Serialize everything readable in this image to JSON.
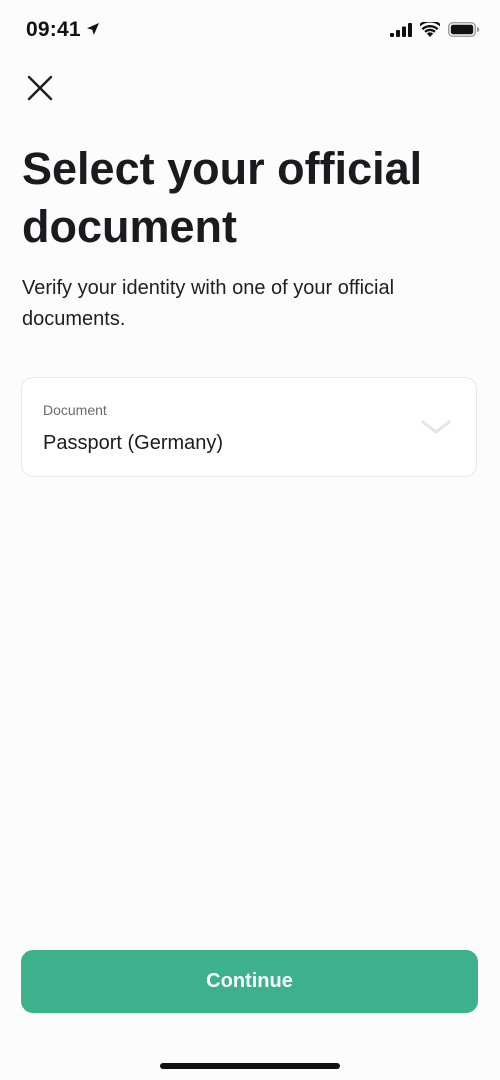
{
  "status_bar": {
    "time": "09:41"
  },
  "header": {
    "title": "Select your official document",
    "subtitle": "Verify your identity with one of your official documents."
  },
  "document_select": {
    "label": "Document",
    "value": "Passport (Germany)"
  },
  "actions": {
    "continue_label": "Continue"
  },
  "colors": {
    "primary": "#3db08c",
    "background": "#fdfcfd",
    "text": "#1c1b1f",
    "muted": "#6b6a70",
    "border": "#e8e6ea"
  },
  "icons": [
    "location-arrow-icon",
    "signal-icon",
    "wifi-icon",
    "battery-icon",
    "close-icon",
    "chevron-down-icon"
  ]
}
